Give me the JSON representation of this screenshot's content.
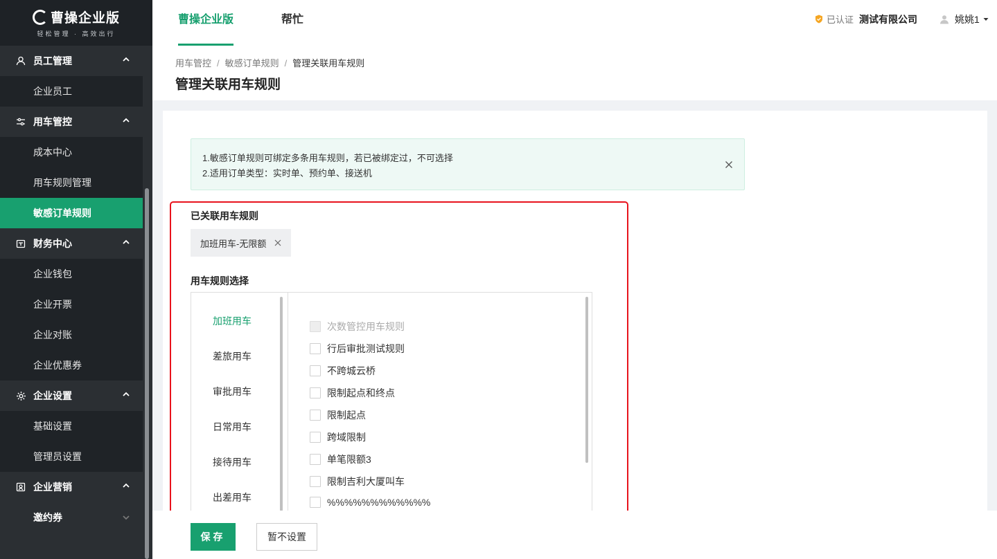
{
  "logo": {
    "title": "曹操企业版",
    "subtitle": "轻松管理 · 高效出行"
  },
  "sidebar": {
    "groups": [
      {
        "label": "员工管理",
        "icon": "user-icon",
        "items": [
          "企业员工"
        ]
      },
      {
        "label": "用车管控",
        "icon": "sliders-icon",
        "items": [
          "成本中心",
          "用车规则管理",
          "敏感订单规则"
        ]
      },
      {
        "label": "财务中心",
        "icon": "wallet-icon",
        "items": [
          "企业钱包",
          "企业开票",
          "企业对账",
          "企业优惠券"
        ]
      },
      {
        "label": "企业设置",
        "icon": "gear-icon",
        "items": [
          "基础设置",
          "管理员设置"
        ]
      },
      {
        "label": "企业营销",
        "icon": "gift-icon",
        "items": [
          "邀约券"
        ]
      }
    ],
    "active_item": "敏感订单规则"
  },
  "topbar": {
    "tabs": [
      "曹操企业版",
      "帮忙"
    ],
    "active_tab": "曹操企业版",
    "verified_label": "已认证",
    "company": "测试有限公司",
    "user": "姚姚1"
  },
  "breadcrumb": {
    "items": [
      "用车管控",
      "敏感订单规则",
      "管理关联用车规则"
    ]
  },
  "page_title": "管理关联用车规则",
  "notice": {
    "line1": "1.敏感订单规则可绑定多条用车规则，若已被绑定过，不可选择",
    "line2": "2.适用订单类型：实时单、预约单、接送机"
  },
  "linked": {
    "label": "已关联用车规则",
    "tags": [
      "加班用车-无限额"
    ]
  },
  "selection": {
    "label": "用车规则选择",
    "categories": [
      "加班用车",
      "差旅用车",
      "审批用车",
      "日常用车",
      "接待用车",
      "出差用车"
    ],
    "active_category": "加班用车",
    "options": [
      {
        "label": "次数管控用车规则",
        "disabled": true
      },
      {
        "label": "行后审批测试规则",
        "disabled": false
      },
      {
        "label": "不跨城云桥",
        "disabled": false
      },
      {
        "label": "限制起点和终点",
        "disabled": false
      },
      {
        "label": "限制起点",
        "disabled": false
      },
      {
        "label": "跨域限制",
        "disabled": false
      },
      {
        "label": "单笔限额3",
        "disabled": false
      },
      {
        "label": "限制吉利大厦叫车",
        "disabled": false
      },
      {
        "label": "%%%%%%%%%%%%",
        "disabled": false
      }
    ]
  },
  "footer": {
    "save_label": "保存",
    "skip_label": "暂不设置"
  },
  "colors": {
    "accent": "#18a06f",
    "sidebar_bg": "#2b2f33",
    "highlight": "#e8121c"
  }
}
